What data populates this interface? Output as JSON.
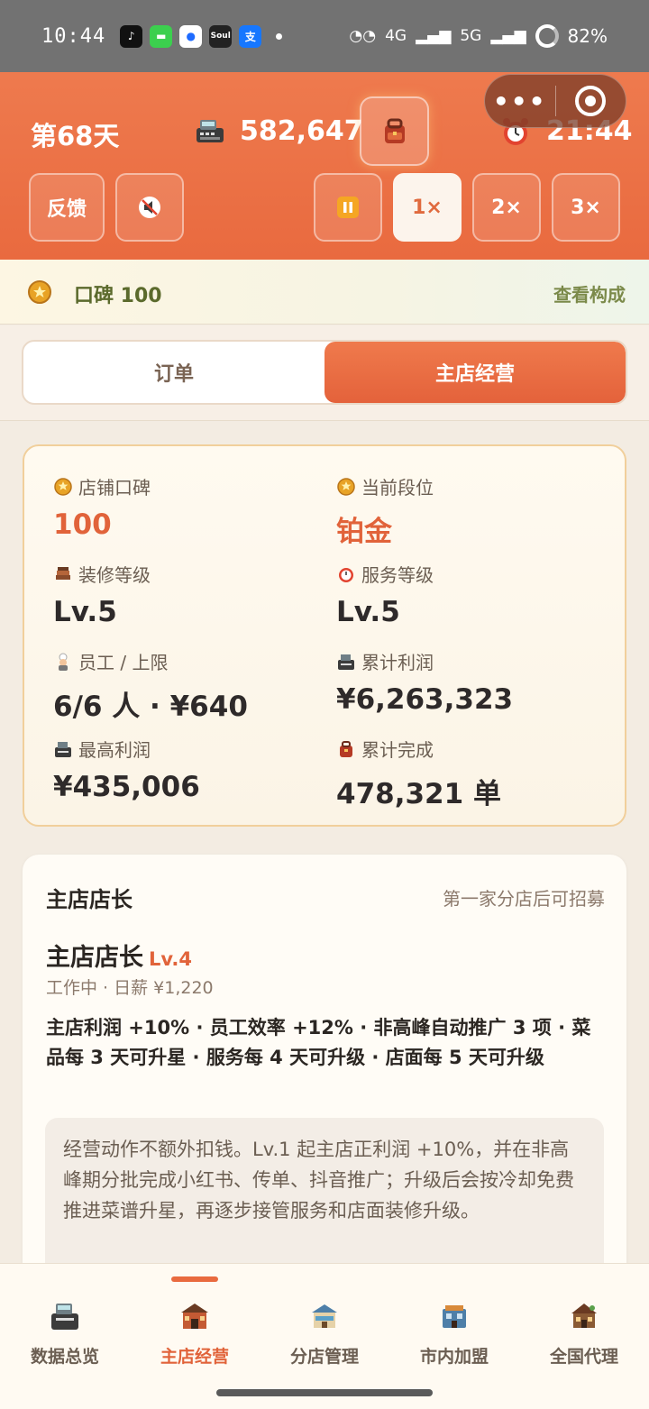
{
  "status_bar": {
    "time": "10:44",
    "apps": [
      {
        "icon": "tiktok-icon",
        "glyph": "♪",
        "color": "#111111"
      },
      {
        "icon": "messages-icon",
        "glyph": "▬",
        "color": "#3ccf4e"
      },
      {
        "icon": "browser-icon",
        "glyph": "●",
        "color": "#1e6bff"
      },
      {
        "icon": "soul-icon",
        "glyph": "Soul",
        "color": "#222222"
      },
      {
        "icon": "alipay-icon",
        "glyph": "支",
        "color": "#1677ff"
      }
    ],
    "network": "4G",
    "network2": "5G",
    "battery": "82%"
  },
  "header": {
    "day": "第68天",
    "cash": "582,647",
    "clock": "21:44",
    "feedback_label": "反馈",
    "speeds": [
      "1×",
      "2×",
      "3×"
    ],
    "active_speed": "1×"
  },
  "reputation": {
    "text": "口碑 100",
    "link": "查看构成"
  },
  "tabs": {
    "orders": "订单",
    "main_store": "主店经营",
    "active": "主店经营"
  },
  "stats": {
    "rep_label": "店铺口碑",
    "rep_value": "100",
    "tier_label": "当前段位",
    "tier_value": "铂金",
    "decor_label": "装修等级",
    "decor_value": "Lv.5",
    "service_label": "服务等级",
    "service_value": "Lv.5",
    "staff_label": "员工 / 上限",
    "staff_value": "6/6 人 · ¥640",
    "total_profit_label": "累计利润",
    "total_profit_value": "¥6,263,323",
    "max_profit_label": "最高利润",
    "max_profit_value": "¥435,006",
    "total_orders_label": "累计完成",
    "total_orders_value": "478,321 单"
  },
  "manager": {
    "title": "主店店长",
    "note": "第一家分店后可招募",
    "name": "主店店长",
    "level": "Lv.4",
    "status": "工作中 · 日薪 ¥1,220",
    "bonus": "主店利润 +10% · 员工效率 +12% · 非高峰自动推广 3 项 · 菜品每 3 天可升星 · 服务每 4 天可升级 · 店面每 5 天可升级",
    "description": "经营动作不额外扣钱。Lv.1 起主店正利润 +10%，并在非高峰期分批完成小红书、传单、抖音推广；升级后会按冷却免费推进菜谱升星，再逐步接管服务和店面装修升级。"
  },
  "nav": {
    "items": [
      {
        "label": "数据总览",
        "icon": "cash-register-icon"
      },
      {
        "label": "主店经营",
        "icon": "restaurant-icon"
      },
      {
        "label": "分店管理",
        "icon": "branch-store-icon"
      },
      {
        "label": "市内加盟",
        "icon": "city-franchise-icon"
      },
      {
        "label": "全国代理",
        "icon": "national-agency-icon"
      }
    ],
    "active": "主店经营"
  },
  "colors": {
    "accent": "#e96a3f",
    "accent_text": "#e1633a",
    "reputation_text": "#5b6a2c"
  }
}
